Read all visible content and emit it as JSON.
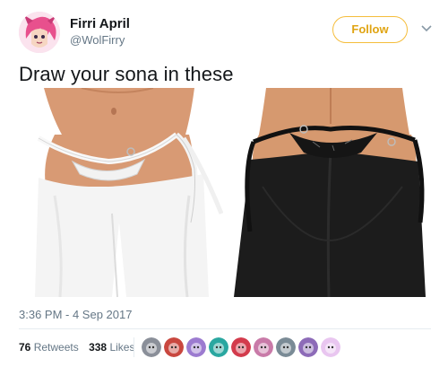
{
  "tweet": {
    "user": {
      "name": "Firri April",
      "handle": "@WolFirry"
    },
    "follow_label": "Follow",
    "text": "Draw your sona in these",
    "timestamp": "3:36 PM - 4 Sep 2017",
    "stats": {
      "retweets_count": "76",
      "retweets_label": "Retweets",
      "likes_count": "338",
      "likes_label": "Likes"
    },
    "colors": {
      "follow_accent": "#e0a412",
      "text": "#14171a",
      "secondary": "#657786",
      "divider": "#e6ecf0"
    },
    "likers": [
      {
        "icon": "gray-gear-avatar",
        "color": "#8a8f99"
      },
      {
        "icon": "red-character-avatar",
        "color": "#c9473f"
      },
      {
        "icon": "purple-character-avatar",
        "color": "#9c7bd0"
      },
      {
        "icon": "teal-character-avatar",
        "color": "#2aa7a0"
      },
      {
        "icon": "red-fox-avatar",
        "color": "#d33b4c"
      },
      {
        "icon": "pink-character-avatar",
        "color": "#c97aa8"
      },
      {
        "icon": "gray-wolf-avatar",
        "color": "#7a8b96"
      },
      {
        "icon": "purple-cat-avatar",
        "color": "#8d6bb8"
      },
      {
        "icon": "pastel-flower-avatar",
        "color": "#e9c6f0"
      }
    ]
  }
}
